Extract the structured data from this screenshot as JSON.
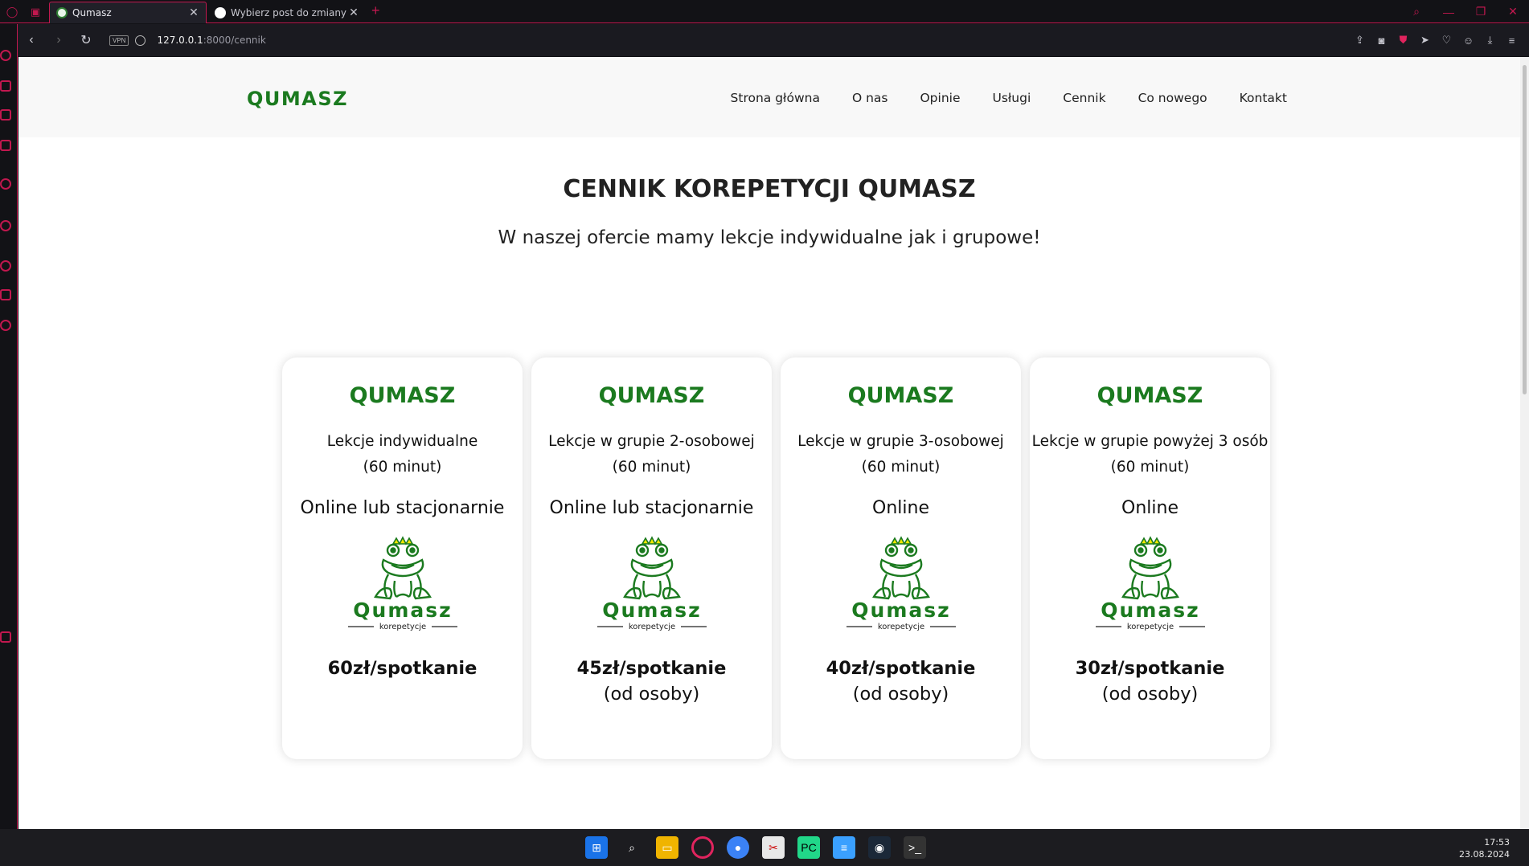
{
  "browser": {
    "tabs": [
      {
        "title": "Qumasz",
        "active": true
      },
      {
        "title": "Wybierz post do zmiany | A",
        "active": false
      }
    ],
    "url_host": "127.0.0.1",
    "url_rest": ":8000/cennik",
    "vpn_label": "VPN"
  },
  "site": {
    "brand": "QUMASZ",
    "nav": [
      "Strona główna",
      "O nas",
      "Opinie",
      "Usługi",
      "Cennik",
      "Co nowego",
      "Kontakt"
    ]
  },
  "page": {
    "title": "CENNIK KOREPETYCJI QUMASZ",
    "subtitle": "W naszej ofercie mamy lekcje indywidualne jak i grupowe!"
  },
  "cards": [
    {
      "title": "QUMASZ",
      "type": "Lekcje indywidualne",
      "duration": "(60 minut)",
      "mode": "Online lub stacjonarnie",
      "price": "60zł/spotkanie",
      "per": ""
    },
    {
      "title": "QUMASZ",
      "type": "Lekcje w grupie 2-osobowej",
      "duration": "(60 minut)",
      "mode": "Online lub stacjonarnie",
      "price": "45zł/spotkanie",
      "per": "(od osoby)"
    },
    {
      "title": "QUMASZ",
      "type": "Lekcje w grupie 3-osobowej",
      "duration": "(60 minut)",
      "mode": "Online",
      "price": "40zł/spotkanie",
      "per": "(od osoby)"
    },
    {
      "title": "QUMASZ",
      "type": "Lekcje w grupie powyżej 3 osób",
      "duration": "(60 minut)",
      "mode": "Online",
      "price": "30zł/spotkanie",
      "per": "(od osoby)"
    }
  ],
  "logo": {
    "word": "Qumasz",
    "tagline": "korepetycje"
  },
  "taskbar": {
    "time": "17:53",
    "date": "23.08.2024"
  },
  "colors": {
    "brand_green": "#1b7a1f",
    "browser_accent": "#c2184f"
  }
}
